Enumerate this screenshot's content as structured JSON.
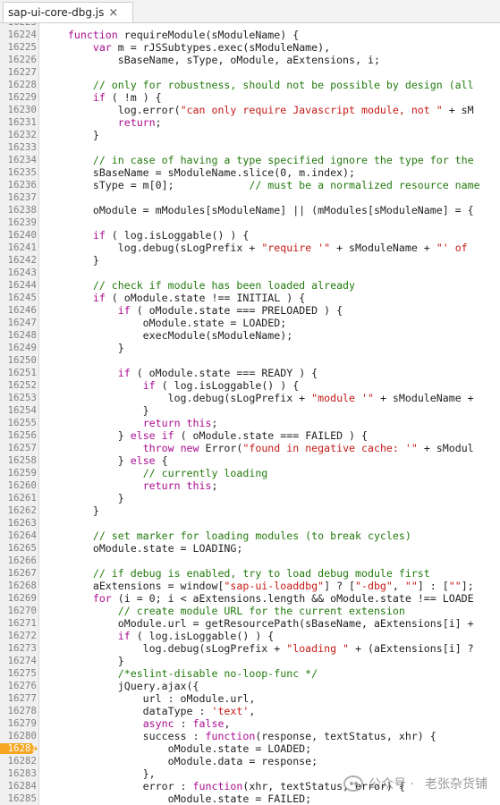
{
  "tab": {
    "filename": "sap-ui-core-dbg.js",
    "close_glyph": "×"
  },
  "breakpoint_line": "16281",
  "watermark": {
    "prefix": "公众号 ·",
    "name": "老张杂货铺"
  },
  "lines": [
    {
      "n": "16223",
      "c": []
    },
    {
      "n": "16224",
      "c": [
        [
          "",
          "\t"
        ],
        [
          "kw",
          "function"
        ],
        [
          "",
          " requireModule(sModuleName) {"
        ]
      ]
    },
    {
      "n": "16225",
      "c": [
        [
          "",
          "\t\t"
        ],
        [
          "kw",
          "var"
        ],
        [
          "",
          " m = rJSSubtypes.exec(sModuleName),"
        ]
      ]
    },
    {
      "n": "16226",
      "c": [
        [
          "",
          "\t\t\tsBaseName, sType, oModule, aExtensions, i;"
        ]
      ]
    },
    {
      "n": "16227",
      "c": []
    },
    {
      "n": "16228",
      "c": [
        [
          "",
          "\t\t"
        ],
        [
          "cmt",
          "// only for robustness, should not be possible by design (all"
        ]
      ]
    },
    {
      "n": "16229",
      "c": [
        [
          "",
          "\t\t"
        ],
        [
          "kw",
          "if"
        ],
        [
          "",
          " ( !m ) {"
        ]
      ]
    },
    {
      "n": "16230",
      "c": [
        [
          "",
          "\t\t\tlog.error("
        ],
        [
          "str",
          "\"can only require Javascript module, not \""
        ],
        [
          "",
          " + sM"
        ]
      ]
    },
    {
      "n": "16231",
      "c": [
        [
          "",
          "\t\t\t"
        ],
        [
          "kw",
          "return"
        ],
        [
          "",
          ";"
        ]
      ]
    },
    {
      "n": "16232",
      "c": [
        [
          "",
          "\t\t}"
        ]
      ]
    },
    {
      "n": "16233",
      "c": []
    },
    {
      "n": "16234",
      "c": [
        [
          "",
          "\t\t"
        ],
        [
          "cmt",
          "// in case of having a type specified ignore the type for the"
        ]
      ]
    },
    {
      "n": "16235",
      "c": [
        [
          "",
          "\t\tsBaseName = sModuleName.slice(0, m.index);"
        ]
      ]
    },
    {
      "n": "16236",
      "c": [
        [
          "",
          "\t\tsType = m[0];\t\t\t"
        ],
        [
          "cmt",
          "// must be a normalized resource name"
        ]
      ]
    },
    {
      "n": "16237",
      "c": []
    },
    {
      "n": "16238",
      "c": [
        [
          "",
          "\t\toModule = mModules[sModuleName] || (mModules[sModuleName] = {"
        ]
      ]
    },
    {
      "n": "16239",
      "c": []
    },
    {
      "n": "16240",
      "c": [
        [
          "",
          "\t\t"
        ],
        [
          "kw",
          "if"
        ],
        [
          "",
          " ( log.isLoggable() ) {"
        ]
      ]
    },
    {
      "n": "16241",
      "c": [
        [
          "",
          "\t\t\tlog.debug(sLogPrefix + "
        ],
        [
          "str",
          "\"require '\""
        ],
        [
          "",
          " + sModuleName + "
        ],
        [
          "str",
          "\"' of"
        ]
      ]
    },
    {
      "n": "16242",
      "c": [
        [
          "",
          "\t\t}"
        ]
      ]
    },
    {
      "n": "16243",
      "c": []
    },
    {
      "n": "16244",
      "c": [
        [
          "",
          "\t\t"
        ],
        [
          "cmt",
          "// check if module has been loaded already"
        ]
      ]
    },
    {
      "n": "16245",
      "c": [
        [
          "",
          "\t\t"
        ],
        [
          "kw",
          "if"
        ],
        [
          "",
          " ( oModule.state !== INITIAL ) {"
        ]
      ]
    },
    {
      "n": "16246",
      "c": [
        [
          "",
          "\t\t\t"
        ],
        [
          "kw",
          "if"
        ],
        [
          "",
          " ( oModule.state === PRELOADED ) {"
        ]
      ]
    },
    {
      "n": "16247",
      "c": [
        [
          "",
          "\t\t\t\toModule.state = LOADED;"
        ]
      ]
    },
    {
      "n": "16248",
      "c": [
        [
          "",
          "\t\t\t\texecModule(sModuleName);"
        ]
      ]
    },
    {
      "n": "16249",
      "c": [
        [
          "",
          "\t\t\t}"
        ]
      ]
    },
    {
      "n": "16250",
      "c": []
    },
    {
      "n": "16251",
      "c": [
        [
          "",
          "\t\t\t"
        ],
        [
          "kw",
          "if"
        ],
        [
          "",
          " ( oModule.state === READY ) {"
        ]
      ]
    },
    {
      "n": "16252",
      "c": [
        [
          "",
          "\t\t\t\t"
        ],
        [
          "kw",
          "if"
        ],
        [
          "",
          " ( log.isLoggable() ) {"
        ]
      ]
    },
    {
      "n": "16253",
      "c": [
        [
          "",
          "\t\t\t\t\tlog.debug(sLogPrefix + "
        ],
        [
          "str",
          "\"module '\""
        ],
        [
          "",
          " + sModuleName +"
        ]
      ]
    },
    {
      "n": "16254",
      "c": [
        [
          "",
          "\t\t\t\t}"
        ]
      ]
    },
    {
      "n": "16255",
      "c": [
        [
          "",
          "\t\t\t\t"
        ],
        [
          "kw",
          "return this"
        ],
        [
          "",
          ";"
        ]
      ]
    },
    {
      "n": "16256",
      "c": [
        [
          "",
          "\t\t\t} "
        ],
        [
          "kw",
          "else if"
        ],
        [
          "",
          " ( oModule.state === FAILED ) {"
        ]
      ]
    },
    {
      "n": "16257",
      "c": [
        [
          "",
          "\t\t\t\t"
        ],
        [
          "kw",
          "throw new"
        ],
        [
          "",
          " Error("
        ],
        [
          "str",
          "\"found in negative cache: '\""
        ],
        [
          "",
          " + sModul"
        ]
      ]
    },
    {
      "n": "16258",
      "c": [
        [
          "",
          "\t\t\t} "
        ],
        [
          "kw",
          "else"
        ],
        [
          "",
          " {"
        ]
      ]
    },
    {
      "n": "16259",
      "c": [
        [
          "",
          "\t\t\t\t"
        ],
        [
          "cmt",
          "// currently loading"
        ]
      ]
    },
    {
      "n": "16260",
      "c": [
        [
          "",
          "\t\t\t\t"
        ],
        [
          "kw",
          "return this"
        ],
        [
          "",
          ";"
        ]
      ]
    },
    {
      "n": "16261",
      "c": [
        [
          "",
          "\t\t\t}"
        ]
      ]
    },
    {
      "n": "16262",
      "c": [
        [
          "",
          "\t\t}"
        ]
      ]
    },
    {
      "n": "16263",
      "c": []
    },
    {
      "n": "16264",
      "c": [
        [
          "",
          "\t\t"
        ],
        [
          "cmt",
          "// set marker for loading modules (to break cycles)"
        ]
      ]
    },
    {
      "n": "16265",
      "c": [
        [
          "",
          "\t\toModule.state = LOADING;"
        ]
      ]
    },
    {
      "n": "16266",
      "c": []
    },
    {
      "n": "16267",
      "c": [
        [
          "",
          "\t\t"
        ],
        [
          "cmt",
          "// if debug is enabled, try to load debug module first"
        ]
      ]
    },
    {
      "n": "16268",
      "c": [
        [
          "",
          "\t\taExtensions = window["
        ],
        [
          "str",
          "\"sap-ui-loaddbg\""
        ],
        [
          "",
          "] ? ["
        ],
        [
          "str",
          "\"-dbg\""
        ],
        [
          "",
          ", "
        ],
        [
          "str",
          "\"\""
        ],
        [
          "",
          "] : ["
        ],
        [
          "str",
          "\"\""
        ],
        [
          "",
          "];"
        ]
      ]
    },
    {
      "n": "16269",
      "c": [
        [
          "",
          "\t\t"
        ],
        [
          "kw",
          "for"
        ],
        [
          "",
          " (i = 0; i < aExtensions.length && oModule.state !== LOADE"
        ]
      ]
    },
    {
      "n": "16270",
      "c": [
        [
          "",
          "\t\t\t"
        ],
        [
          "cmt",
          "// create module URL for the current extension"
        ]
      ]
    },
    {
      "n": "16271",
      "c": [
        [
          "",
          "\t\t\toModule.url = getResourcePath(sBaseName, aExtensions[i] +"
        ]
      ]
    },
    {
      "n": "16272",
      "c": [
        [
          "",
          "\t\t\t"
        ],
        [
          "kw",
          "if"
        ],
        [
          "",
          " ( log.isLoggable() ) {"
        ]
      ]
    },
    {
      "n": "16273",
      "c": [
        [
          "",
          "\t\t\t\tlog.debug(sLogPrefix + "
        ],
        [
          "str",
          "\"loading \""
        ],
        [
          "",
          " + (aExtensions[i] ?"
        ]
      ]
    },
    {
      "n": "16274",
      "c": [
        [
          "",
          "\t\t\t}"
        ]
      ]
    },
    {
      "n": "16275",
      "c": [
        [
          "",
          "\t\t\t"
        ],
        [
          "cmt",
          "/*eslint-disable no-loop-func */"
        ]
      ]
    },
    {
      "n": "16276",
      "c": [
        [
          "",
          "\t\t\tjQuery.ajax({"
        ]
      ]
    },
    {
      "n": "16277",
      "c": [
        [
          "",
          "\t\t\t\turl : oModule.url,"
        ]
      ]
    },
    {
      "n": "16278",
      "c": [
        [
          "",
          "\t\t\t\tdataType : "
        ],
        [
          "str",
          "'text'"
        ],
        [
          "",
          ","
        ]
      ]
    },
    {
      "n": "16279",
      "c": [
        [
          "",
          "\t\t\t\t"
        ],
        [
          "kw",
          "async"
        ],
        [
          "",
          " : "
        ],
        [
          "kw",
          "false"
        ],
        [
          "",
          ","
        ]
      ]
    },
    {
      "n": "16280",
      "c": [
        [
          "",
          "\t\t\t\tsuccess : "
        ],
        [
          "kw",
          "function"
        ],
        [
          "",
          "(response, textStatus, xhr) {"
        ]
      ]
    },
    {
      "n": "16281",
      "c": [
        [
          "",
          "\t\t\t\t\toModule.state = LOADED;"
        ]
      ]
    },
    {
      "n": "16282",
      "c": [
        [
          "",
          "\t\t\t\t\toModule.data = response;"
        ]
      ]
    },
    {
      "n": "16283",
      "c": [
        [
          "",
          "\t\t\t\t},"
        ]
      ]
    },
    {
      "n": "16284",
      "c": [
        [
          "",
          "\t\t\t\terror : "
        ],
        [
          "kw",
          "function"
        ],
        [
          "",
          "(xhr, textStatus, error) {"
        ]
      ]
    },
    {
      "n": "16285",
      "c": [
        [
          "",
          "\t\t\t\t\toModule.state = FAILED;"
        ]
      ]
    }
  ]
}
